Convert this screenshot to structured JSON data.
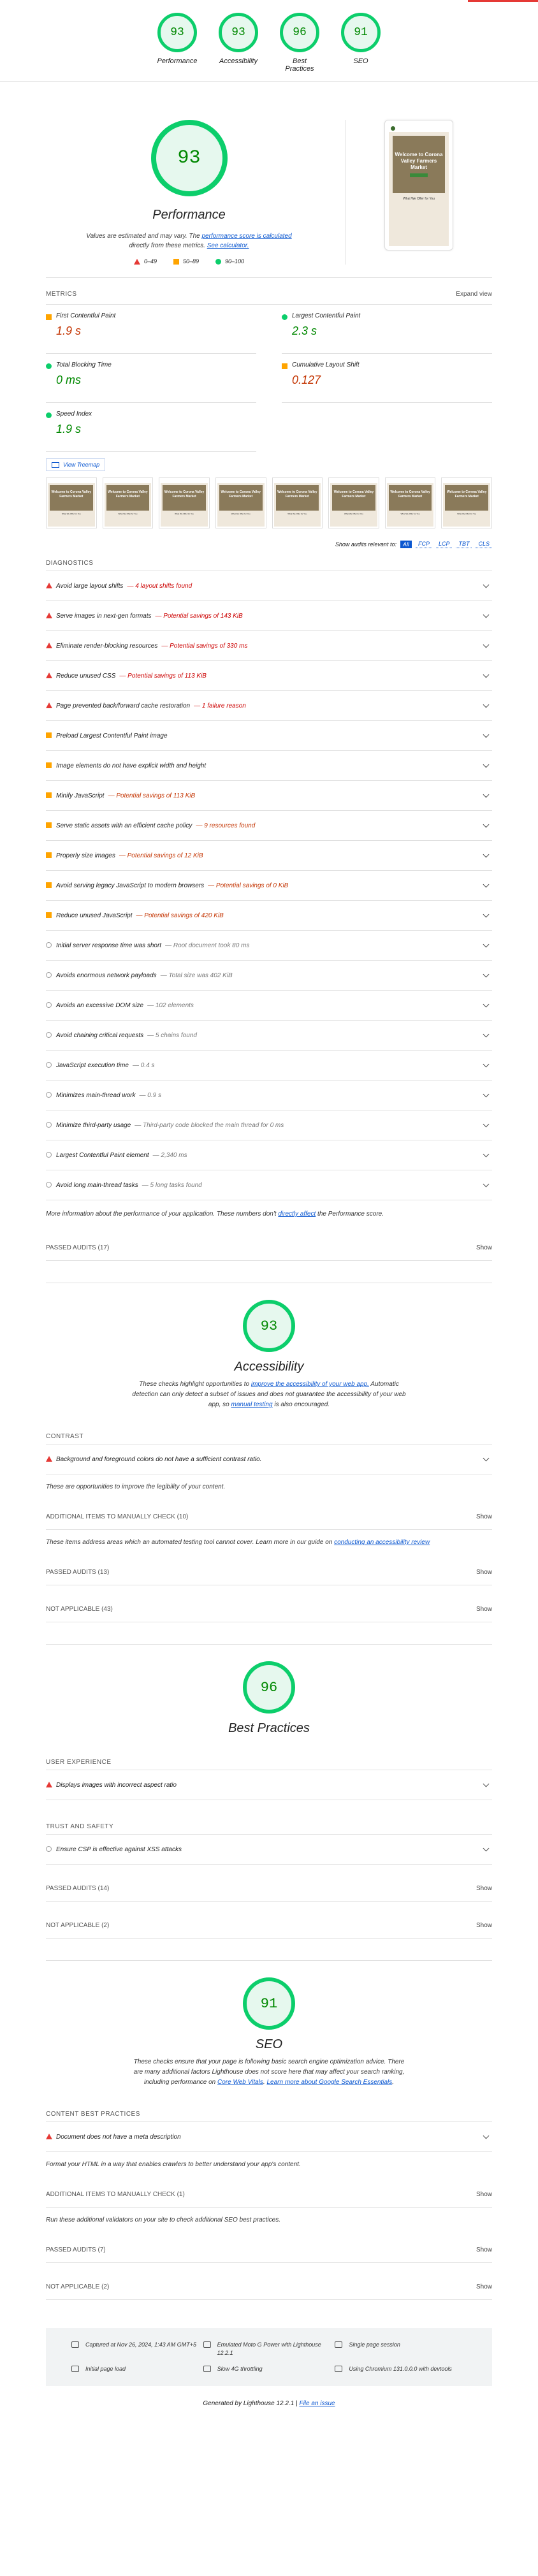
{
  "top": {
    "gauges": [
      {
        "score": "93",
        "label": "Performance"
      },
      {
        "score": "93",
        "label": "Accessibility"
      },
      {
        "score": "96",
        "label": "Best Practices"
      },
      {
        "score": "91",
        "label": "SEO"
      }
    ]
  },
  "performance": {
    "score": "93",
    "title": "Performance",
    "desc_1": "Values are estimated and may vary. The",
    "desc_link": "performance score is calculated",
    "desc_2": "directly from these metrics.",
    "desc_link2": "See calculator.",
    "legend": [
      "0–49",
      "50–89",
      "90–100"
    ],
    "screenshot": {
      "hero": "Welcome to Corona Valley Farmers Market",
      "sub": "What We Offer for You"
    },
    "metrics_label": "METRICS",
    "expand_view": "Expand view",
    "metrics": [
      {
        "name": "First Contentful Paint",
        "value": "1.9 s",
        "status": "avg"
      },
      {
        "name": "Largest Contentful Paint",
        "value": "2.3 s",
        "status": "good"
      },
      {
        "name": "Total Blocking Time",
        "value": "0 ms",
        "status": "good"
      },
      {
        "name": "Cumulative Layout Shift",
        "value": "0.127",
        "status": "avg"
      },
      {
        "name": "Speed Index",
        "value": "1.9 s",
        "status": "good"
      }
    ],
    "view_treemap": "View Treemap",
    "show_audits_label": "Show audits relevant to:",
    "chips": [
      "All",
      "FCP",
      "LCP",
      "TBT",
      "CLS"
    ],
    "diagnostics_label": "DIAGNOSTICS",
    "audits": [
      {
        "icon": "fail",
        "title": "Avoid large layout shifts",
        "detail": "— 4 layout shifts found",
        "cls": "red"
      },
      {
        "icon": "fail",
        "title": "Serve images in next-gen formats",
        "detail": "— Potential savings of 143 KiB",
        "cls": "red"
      },
      {
        "icon": "fail",
        "title": "Eliminate render-blocking resources",
        "detail": "— Potential savings of 330 ms",
        "cls": "red"
      },
      {
        "icon": "fail",
        "title": "Reduce unused CSS",
        "detail": "— Potential savings of 113 KiB",
        "cls": "red"
      },
      {
        "icon": "fail",
        "title": "Page prevented back/forward cache restoration",
        "detail": "— 1 failure reason",
        "cls": "red"
      },
      {
        "icon": "avg",
        "title": "Preload Largest Contentful Paint image",
        "detail": "",
        "cls": "or"
      },
      {
        "icon": "avg",
        "title": "Image elements do not have explicit width and height",
        "detail": "",
        "cls": "or"
      },
      {
        "icon": "avg",
        "title": "Minify JavaScript",
        "detail": "— Potential savings of 113 KiB",
        "cls": "or"
      },
      {
        "icon": "avg",
        "title": "Serve static assets with an efficient cache policy",
        "detail": "— 9 resources found",
        "cls": "or"
      },
      {
        "icon": "avg",
        "title": "Properly size images",
        "detail": "— Potential savings of 12 KiB",
        "cls": "or"
      },
      {
        "icon": "avg",
        "title": "Avoid serving legacy JavaScript to modern browsers",
        "detail": "— Potential savings of 0 KiB",
        "cls": "or"
      },
      {
        "icon": "avg",
        "title": "Reduce unused JavaScript",
        "detail": "— Potential savings of 420 KiB",
        "cls": "or"
      },
      {
        "icon": "info",
        "title": "Initial server response time was short",
        "detail": "— Root document took 80 ms",
        "cls": "gr"
      },
      {
        "icon": "info",
        "title": "Avoids enormous network payloads",
        "detail": "— Total size was 402 KiB",
        "cls": "gr"
      },
      {
        "icon": "info",
        "title": "Avoids an excessive DOM size",
        "detail": "— 102 elements",
        "cls": "gr"
      },
      {
        "icon": "info",
        "title": "Avoid chaining critical requests",
        "detail": "— 5 chains found",
        "cls": "gr"
      },
      {
        "icon": "info",
        "title": "JavaScript execution time",
        "detail": "— 0.4 s",
        "cls": "gr"
      },
      {
        "icon": "info",
        "title": "Minimizes main-thread work",
        "detail": "— 0.9 s",
        "cls": "gr"
      },
      {
        "icon": "info",
        "title": "Minimize third-party usage",
        "detail": "— Third-party code blocked the main thread for 0 ms",
        "cls": "gr"
      },
      {
        "icon": "info",
        "title": "Largest Contentful Paint element",
        "detail": "— 2,340 ms",
        "cls": "gr"
      },
      {
        "icon": "info",
        "title": "Avoid long main-thread tasks",
        "detail": "— 5 long tasks found",
        "cls": "gr"
      }
    ],
    "more_info_1": "More information about the performance of your application. These numbers don't",
    "more_info_link": "directly affect",
    "more_info_2": "the Performance score.",
    "passed": "PASSED AUDITS (17)",
    "show": "Show"
  },
  "accessibility": {
    "score": "93",
    "title": "Accessibility",
    "desc_1": "These checks highlight opportunities to",
    "desc_link": "improve the accessibility of your web app.",
    "desc_2": "Automatic detection can only detect a subset of issues and does not guarantee the accessibility of your web app, so",
    "desc_link2": "manual testing",
    "desc_3": "is also encouraged.",
    "contrast_label": "CONTRAST",
    "contrast_audit": "Background and foreground colors do not have a sufficient contrast ratio.",
    "contrast_note": "These are opportunities to improve the legibility of your content.",
    "manual": "ADDITIONAL ITEMS TO MANUALLY CHECK (10)",
    "manual_note_1": "These items address areas which an automated testing tool cannot cover. Learn more in our guide on",
    "manual_note_link": "conducting an accessibility review",
    "passed": "PASSED AUDITS (13)",
    "na": "NOT APPLICABLE (43)",
    "show": "Show"
  },
  "best_practices": {
    "score": "96",
    "title": "Best Practices",
    "ux_label": "USER EXPERIENCE",
    "ux_audit": "Displays images with incorrect aspect ratio",
    "trust_label": "TRUST AND SAFETY",
    "trust_audit": "Ensure CSP is effective against XSS attacks",
    "passed": "PASSED AUDITS (14)",
    "na": "NOT APPLICABLE (2)",
    "show": "Show"
  },
  "seo": {
    "score": "91",
    "title": "SEO",
    "desc_1": "These checks ensure that your page is following basic search engine optimization advice. There are many additional factors Lighthouse does not score here that may affect your search ranking, including performance on",
    "desc_link": "Core Web Vitals",
    "desc_link2": "Learn more about Google Search Essentials",
    "content_label": "CONTENT BEST PRACTICES",
    "content_audit": "Document does not have a meta description",
    "content_note": "Format your HTML in a way that enables crawlers to better understand your app's content.",
    "manual": "ADDITIONAL ITEMS TO MANUALLY CHECK (1)",
    "manual_note": "Run these additional validators on your site to check additional SEO best practices.",
    "passed": "PASSED AUDITS (7)",
    "na": "NOT APPLICABLE (2)",
    "show": "Show"
  },
  "footer": {
    "captured": "Captured at Nov 26, 2024, 1:43 AM GMT+5",
    "device": "Emulated Moto G Power with Lighthouse 12.2.1",
    "session": "Single page session",
    "initial": "Initial page load",
    "throttle": "Slow 4G throttling",
    "browser": "Using Chromium 131.0.0.0 with devtools",
    "generated": "Generated by",
    "generated_tool": "Lighthouse",
    "version": "12.2.1 |",
    "issue": "File an issue"
  }
}
